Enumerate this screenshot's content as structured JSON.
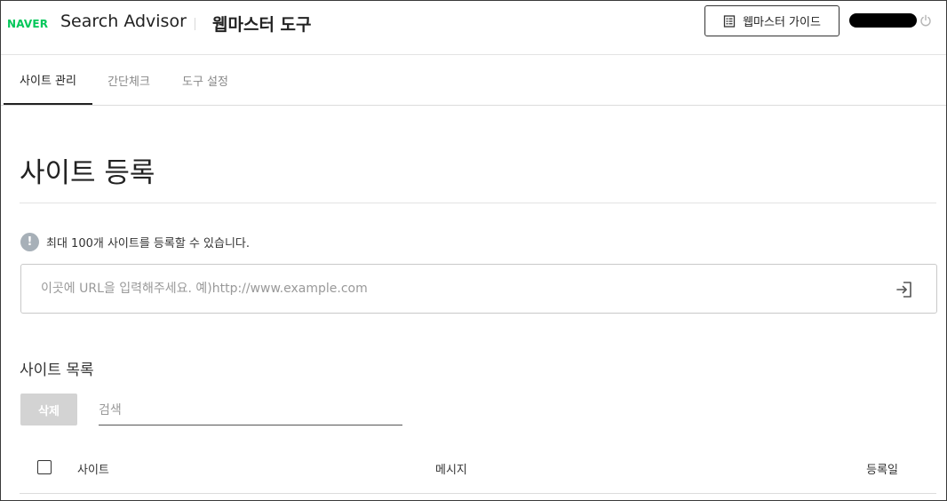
{
  "header": {
    "logo_text": "NAVER",
    "service_name": "Search Advisor",
    "subtitle": "웹마스터 도구",
    "guide_button_label": "웹마스터 가이드",
    "colors": {
      "brand_green": "#03c75a"
    },
    "icons": {
      "guide": "document-list-icon",
      "logout": "power-icon"
    }
  },
  "tabs": [
    {
      "label": "사이트 관리",
      "active": true
    },
    {
      "label": "간단체크",
      "active": false
    },
    {
      "label": "도구 설정",
      "active": false
    }
  ],
  "main": {
    "section_title": "사이트 등록",
    "notice": "최대 100개 사이트를 등록할 수 있습니다.",
    "url_input": {
      "value": "",
      "placeholder": "이곳에 URL을 입력해주세요. 예)http://www.example.com"
    },
    "list_title": "사이트 목록",
    "delete_button_label": "삭제",
    "search": {
      "value": "",
      "placeholder": "검색"
    },
    "table": {
      "columns": [
        "사이트",
        "메시지",
        "등록일"
      ],
      "rows": []
    }
  }
}
